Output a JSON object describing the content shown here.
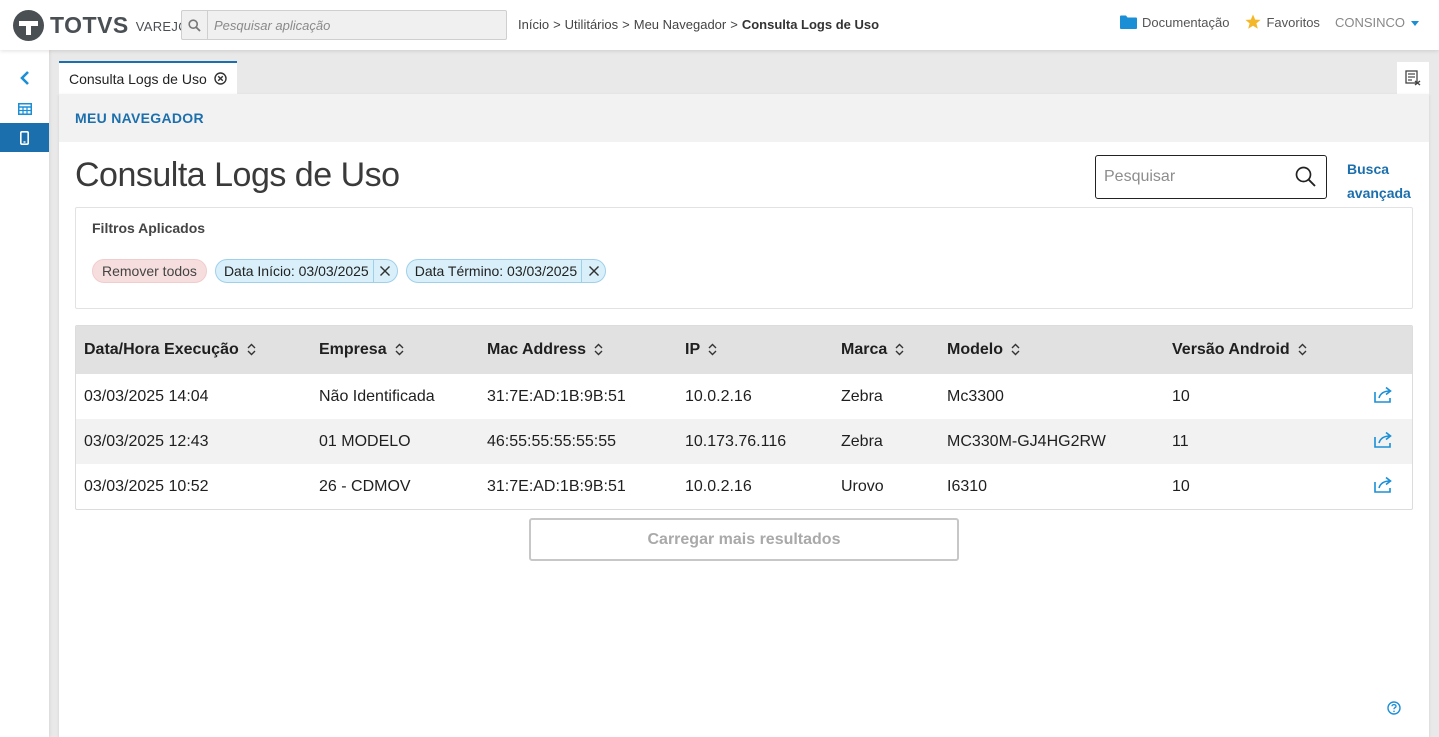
{
  "header": {
    "logo_text": "TOTVS",
    "logo_sub": "VAREJO",
    "search_placeholder": "Pesquisar aplicação",
    "breadcrumb": [
      "Início",
      "Utilitários",
      "Meu Navegador",
      "Consulta Logs de Uso"
    ],
    "breadcrumb_separator": ">",
    "documentation": "Documentação",
    "favorites": "Favoritos",
    "user": "CONSINCO"
  },
  "tabs": [
    {
      "label": "Consulta Logs de Uso"
    }
  ],
  "section": {
    "title": "MEU NAVEGADOR"
  },
  "page": {
    "title": "Consulta Logs de Uso",
    "search_placeholder": "Pesquisar",
    "advanced_search_line1": "Busca",
    "advanced_search_line2": "avançada"
  },
  "filters": {
    "label": "Filtros Aplicados",
    "remove_all": "Remover todos",
    "applied": [
      "Data Início: 03/03/2025",
      "Data Término: 03/03/2025"
    ]
  },
  "table": {
    "columns": [
      "Data/Hora Execução",
      "Empresa",
      "Mac Address",
      "IP",
      "Marca",
      "Modelo",
      "Versão Android"
    ],
    "rows": [
      [
        "03/03/2025 14:04",
        "Não Identificada",
        "31:7E:AD:1B:9B:51",
        "10.0.2.16",
        "Zebra",
        "Mc3300",
        "10"
      ],
      [
        "03/03/2025 12:43",
        "01 MODELO",
        "46:55:55:55:55:55",
        "10.173.76.116",
        "Zebra",
        "MC330M-GJ4HG2RW",
        "11"
      ],
      [
        "03/03/2025 10:52",
        "26 - CDMOV",
        "31:7E:AD:1B:9B:51",
        "10.0.2.16",
        "Urovo",
        "I6310",
        "10"
      ]
    ]
  },
  "load_more": "Carregar mais resultados",
  "colors": {
    "primary": "#1c6fad",
    "accent_blue": "#1a8fd6",
    "star": "#f5b72a"
  }
}
